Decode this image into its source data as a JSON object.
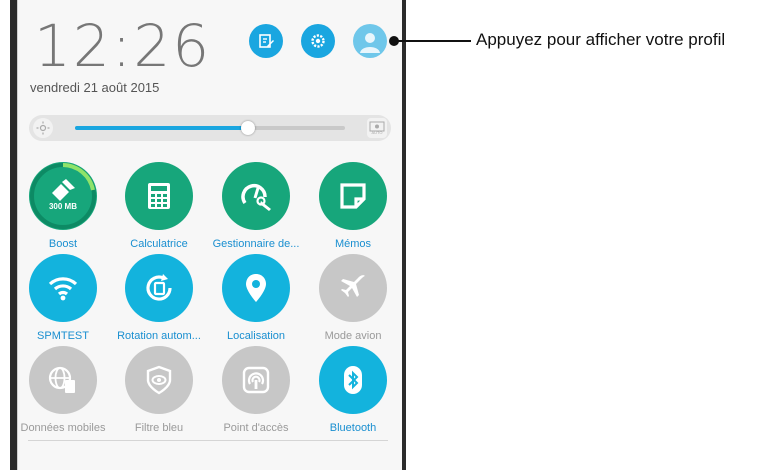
{
  "status": {
    "time": "12:26",
    "date": "vendredi 21 août 2015"
  },
  "header_buttons": [
    {
      "icon": "edit-icon"
    },
    {
      "icon": "settings-icon"
    },
    {
      "icon": "profile-icon"
    }
  ],
  "brightness": {
    "level": 0.64,
    "auto_label": "AUTO"
  },
  "tiles": [
    {
      "label": "Boost",
      "sub": "300 MB",
      "icon": "boost-icon",
      "state": "on",
      "color": "#17a67b"
    },
    {
      "label": "Calculatrice",
      "icon": "calculator-icon",
      "state": "on",
      "color": "#17a67b"
    },
    {
      "label": "Gestionnaire de...",
      "icon": "gauge-wrench-icon",
      "state": "on",
      "color": "#17a67b"
    },
    {
      "label": "Mémos",
      "icon": "memo-icon",
      "state": "on",
      "color": "#17a67b"
    },
    {
      "label": "SPMTEST",
      "icon": "wifi-icon",
      "state": "on",
      "color": "#13b3dd"
    },
    {
      "label": "Rotation autom...",
      "icon": "rotation-icon",
      "state": "on",
      "color": "#13b3dd"
    },
    {
      "label": "Localisation",
      "icon": "location-icon",
      "state": "on",
      "color": "#13b3dd"
    },
    {
      "label": "Mode avion",
      "icon": "airplane-icon",
      "state": "off",
      "color": "#c7c7c7"
    },
    {
      "label": "Données mobiles",
      "icon": "mobile-data-icon",
      "state": "off",
      "color": "#c7c7c7"
    },
    {
      "label": "Filtre bleu",
      "icon": "blue-filter-icon",
      "state": "off",
      "color": "#c7c7c7"
    },
    {
      "label": "Point d'accès",
      "icon": "hotspot-icon",
      "state": "off",
      "color": "#c7c7c7"
    },
    {
      "label": "Bluetooth",
      "icon": "bluetooth-icon",
      "state": "on",
      "color": "#13b3dd"
    }
  ],
  "callout": {
    "text": "Appuyez pour afficher votre profil"
  }
}
